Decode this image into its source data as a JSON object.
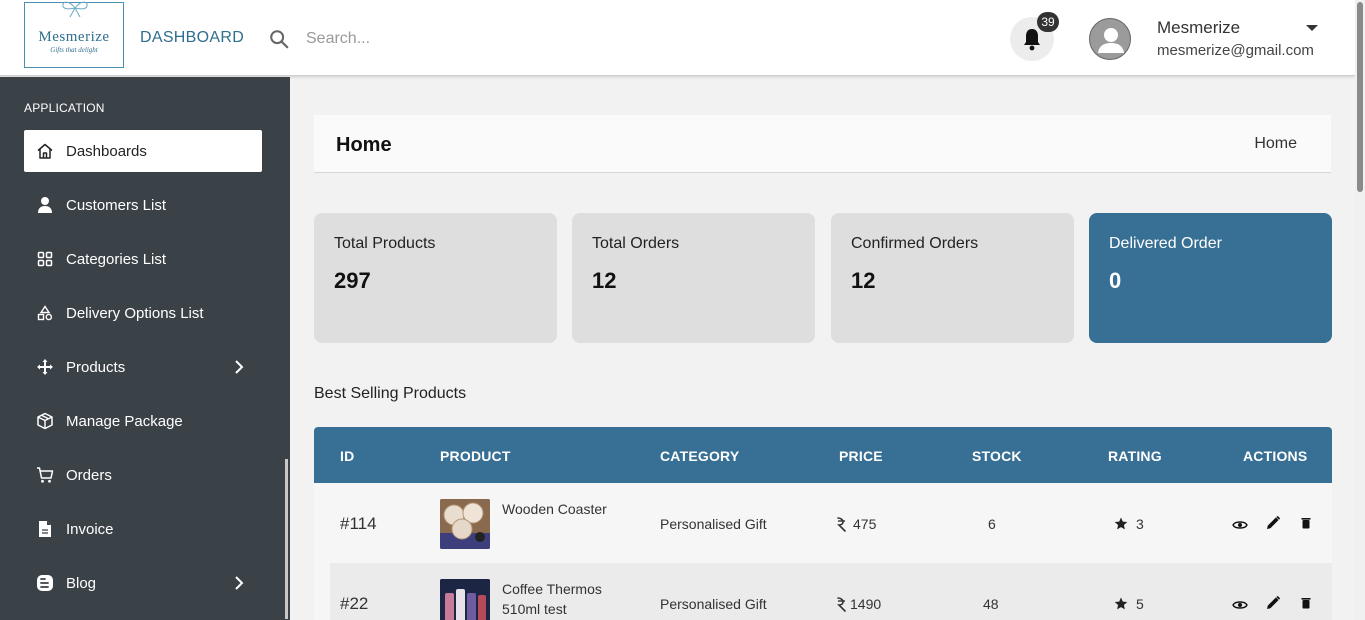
{
  "brand": {
    "logo_title": "Mesmerize",
    "logo_subtitle": "Gifts that delight",
    "dashboard_link": "DASHBOARD"
  },
  "header": {
    "search_placeholder": "Search...",
    "notification_count": "39",
    "user_name": "Mesmerize",
    "user_email": "mesmerize@gmail.com"
  },
  "sidebar": {
    "heading": "APPLICATION",
    "items": [
      {
        "label": "Dashboards",
        "icon": "home-icon",
        "active": true
      },
      {
        "label": "Customers List",
        "icon": "user-icon"
      },
      {
        "label": "Categories List",
        "icon": "grid-icon"
      },
      {
        "label": "Delivery Options List",
        "icon": "shapes-icon"
      },
      {
        "label": "Products",
        "icon": "move-icon",
        "has_submenu": true
      },
      {
        "label": "Manage Package",
        "icon": "package-icon"
      },
      {
        "label": "Orders",
        "icon": "cart-icon"
      },
      {
        "label": "Invoice",
        "icon": "file-icon"
      },
      {
        "label": "Blog",
        "icon": "blog-icon",
        "has_submenu": true
      }
    ]
  },
  "page": {
    "title": "Home",
    "breadcrumb": "Home"
  },
  "stats": [
    {
      "label": "Total Products",
      "value": "297"
    },
    {
      "label": "Total Orders",
      "value": "12"
    },
    {
      "label": "Confirmed Orders",
      "value": "12"
    },
    {
      "label": "Delivered Order",
      "value": "0"
    }
  ],
  "best_selling": {
    "title": "Best Selling Products",
    "columns": [
      "ID",
      "PRODUCT",
      "CATEGORY",
      "PRICE",
      "STOCK",
      "RATING",
      "ACTIONS"
    ],
    "rows": [
      {
        "id": "#114",
        "product": "Wooden Coaster",
        "product_line2": "",
        "category": "Personalised Gift",
        "price": "475",
        "stock": "6",
        "rating": "3"
      },
      {
        "id": "#22",
        "product": "Coffee Thermos",
        "product_line2": "510ml test",
        "category": "Personalised Gift",
        "price": "1490",
        "stock": "48",
        "rating": "5"
      }
    ]
  },
  "colors": {
    "accent": "#386f95",
    "sidebar_bg": "#3a4147",
    "card_bg": "#dedede"
  }
}
